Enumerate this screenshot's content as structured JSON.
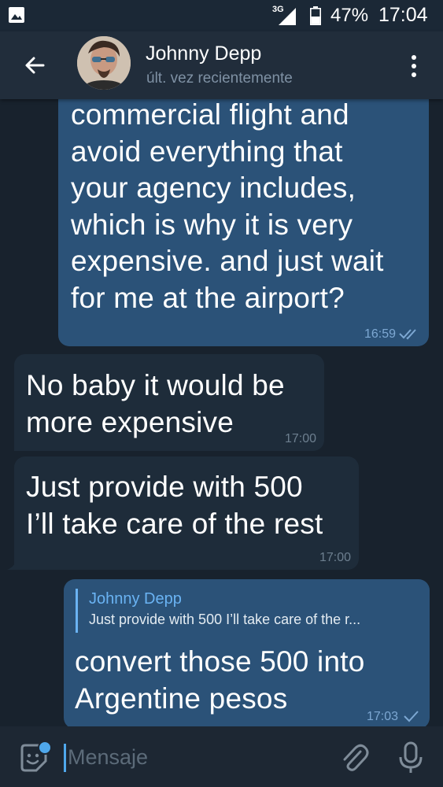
{
  "status_bar": {
    "network_label": "3G",
    "battery_percent": "47%",
    "time": "17:04",
    "icons": [
      "image-icon",
      "signal-icon",
      "battery-icon"
    ]
  },
  "header": {
    "contact_name": "Johnny Depp",
    "last_seen": "últ. vez recientemente",
    "icons": [
      "back-arrow-icon",
      "avatar",
      "more-vert-icon"
    ]
  },
  "messages": [
    {
      "direction": "outgoing",
      "text_lines": [
        "commercial flight and",
        "avoid everything that",
        "your agency includes,",
        "which is why it is very",
        "expensive. and just wait",
        "for me at the airport?"
      ],
      "time": "16:59",
      "status": "read"
    },
    {
      "direction": "incoming",
      "text_lines": [
        "No baby it would be",
        "more expensive"
      ],
      "time": "17:00"
    },
    {
      "direction": "incoming",
      "text_lines": [
        "Just provide with 500",
        "I’ll take care of the rest"
      ],
      "time": "17:00"
    },
    {
      "direction": "outgoing",
      "reply_to": {
        "name": "Johnny Depp",
        "text": "Just provide with 500 I’ll take care of the r..."
      },
      "text_lines": [
        "convert those 500 into",
        "Argentine pesos"
      ],
      "time": "17:03",
      "status": "sent"
    }
  ],
  "composer": {
    "placeholder": "Mensaje",
    "icons": [
      "sticker-emoji-icon",
      "attach-icon",
      "microphone-icon"
    ]
  },
  "colors": {
    "background": "#18222d",
    "outgoing_bubble": "#2b5278",
    "incoming_bubble": "#1e2c3a",
    "accent": "#6ab3f3"
  }
}
